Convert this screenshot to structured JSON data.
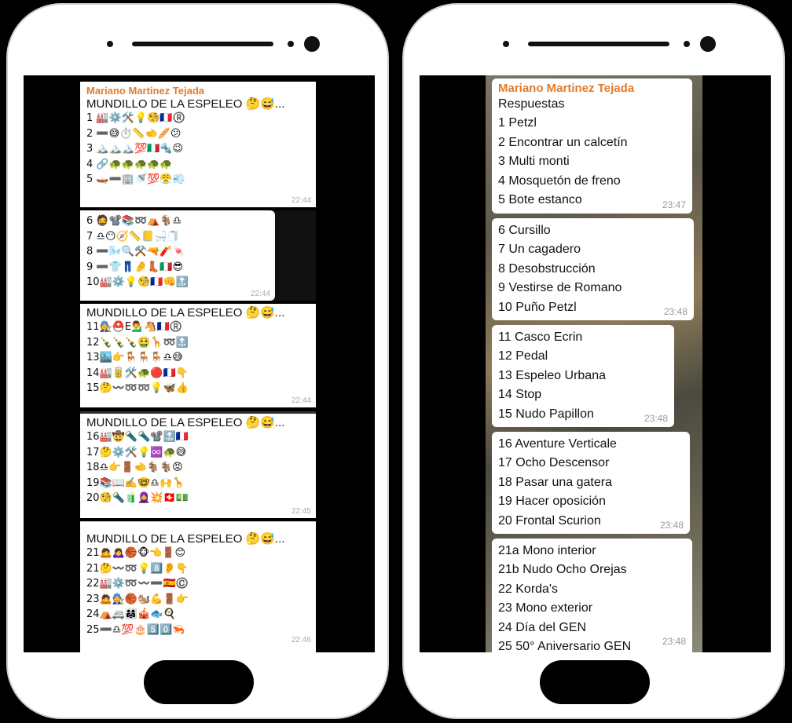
{
  "sender": "Mariano Martinez Tejada",
  "left": {
    "blocks": [
      {
        "title": "MUNDILLO DE LA ESPELEO 🤔😅...",
        "rows": [
          "1 🏭⚙️🛠️💡🧐🇫🇷®️",
          "2 ➖😅⏱️📏🫲🥖😕",
          "3 🏔️🏔️🏔️💯🇮🇹🔩😉",
          "4 🔗🐢🐢🐢🐢🐢",
          "5 🛶➖🏢🚿💯😤💨"
        ],
        "time": "22:44"
      },
      {
        "rows": [
          "6 🧔📽️📚➿⛺🐐♎",
          "7 ♎😶🧭📏📒🛁🧻",
          "8 ➖🌬️🔍⚒️🔫🧨🍬",
          "9 ➖👕👖🤌👢🇮🇹😎",
          "10🏭⚙️💡🧐🇫🇷👊🔝"
        ],
        "time": "22:44"
      },
      {
        "title": "MUNDILLO DE LA ESPELEO 🤔😅...",
        "rows": [
          "11🧑‍🔧⛑️E💁‍♂️🐴🇫🇷®️",
          "12🍾🍾🍾🤮🦒➿🔝",
          "13🏙️👉🪑🪑🪑♎😅",
          "14🏭🥫🛠️🐢🔴🇫🇷👇",
          "15🤔〰️➿➿💡🦋👍"
        ],
        "time": "22:44"
      },
      {
        "title": "MUNDILLO DE LA ESPELEO 🤔😅...",
        "rows": [
          "16🏭🤠🔦🔦📽️🔝🇫🇷",
          "17🤔⚙️🛠️💡♾️🐢😅",
          "18♎👉🚪🫲🐐🐐😡",
          "19📚📖✍️🤓♎🙌🦒",
          "20🧐🔦🧃🧕💥🇨🇭💵"
        ],
        "time": "22:45"
      },
      {
        "title": "MUNDILLO DE LA ESPELEO 🤔😅...",
        "rows": [
          "21🙇🙇‍♀️🏀🐵👈🚪😊",
          "21🤔〰️➿💡8️⃣👂👇",
          "22🏭⚙️➿〰️➖🇪🇸©️",
          "23🙇🧑‍🔧🏀🐿️💪🚪👉",
          "24⛺🚐👨‍👩‍👧🎪🐟🍳",
          "25➖♎💯🎂5️⃣0️⃣🦐"
        ],
        "time": "22:46"
      }
    ]
  },
  "right": {
    "bubbles": [
      {
        "lines": [
          "Respuestas",
          "1 Petzl",
          "2 Encontrar un calcetín",
          "3 Multi monti",
          "4 Mosquetón de freno",
          "5 Bote estanco"
        ],
        "time": "23:47"
      },
      {
        "lines": [
          "6 Cursillo",
          "7 Un cagadero",
          "8 Desobstrucción",
          "9 Vestirse de Romano",
          "10 Puño Petzl"
        ],
        "time": "23:48"
      },
      {
        "lines": [
          "11 Casco Ecrin",
          "12 Pedal",
          "13 Espeleo Urbana",
          "14 Stop",
          "15 Nudo Papillon"
        ],
        "time": "23:48"
      },
      {
        "lines": [
          "16 Aventure Verticale",
          "17 Ocho Descensor",
          "18 Pasar una gatera",
          "19 Hacer oposición",
          "20 Frontal Scurion"
        ],
        "time": "23:48"
      },
      {
        "lines": [
          "21a Mono interior",
          "21b Nudo Ocho Orejas",
          "22  Korda's",
          "23 Mono exterior",
          "24 Día del GEN",
          "25 50° Aniversario GEN"
        ],
        "time": "23:48"
      }
    ]
  }
}
